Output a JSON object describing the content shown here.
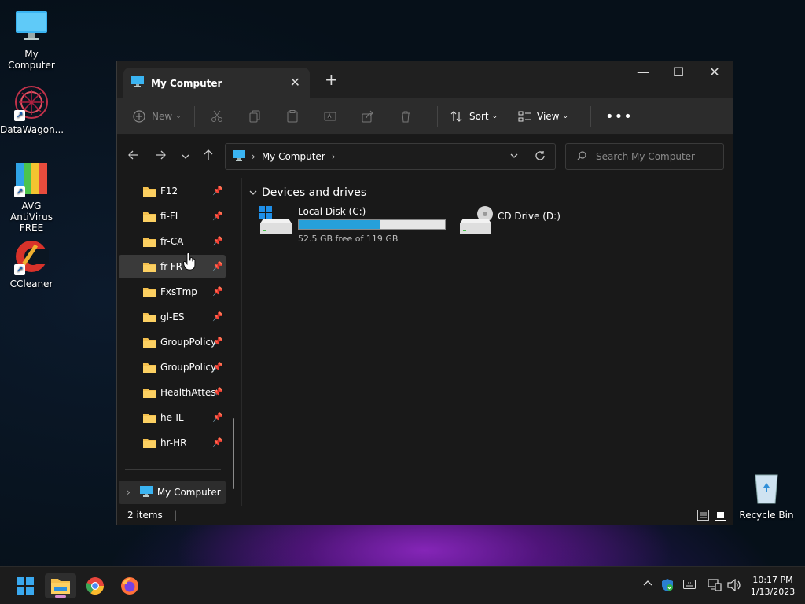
{
  "desktop": {
    "icons": [
      {
        "label": "My Computer"
      },
      {
        "label": "DataWagon..."
      },
      {
        "label": "AVG AntiVirus FREE"
      },
      {
        "label": "CCleaner"
      },
      {
        "label": "Recycle Bin"
      }
    ]
  },
  "window": {
    "tab_title": "My Computer",
    "toolbar": {
      "new_label": "New",
      "sort_label": "Sort",
      "view_label": "View"
    },
    "address": {
      "path": [
        "My Computer"
      ]
    },
    "search": {
      "placeholder": "Search My Computer"
    },
    "nav_pane": {
      "items": [
        {
          "label": "F12"
        },
        {
          "label": "fi-FI"
        },
        {
          "label": "fr-CA"
        },
        {
          "label": "fr-FR"
        },
        {
          "label": "FxsTmp"
        },
        {
          "label": "gl-ES"
        },
        {
          "label": "GroupPolicy"
        },
        {
          "label": "GroupPolicyUsers"
        },
        {
          "label": "HealthAttestation"
        },
        {
          "label": "he-IL"
        },
        {
          "label": "hr-HR"
        }
      ],
      "my_computer_label": "My Computer"
    },
    "content": {
      "group_title": "Devices and drives",
      "drives": [
        {
          "name": "Local Disk (C:)",
          "free_text": "52.5 GB free of 119 GB",
          "used_fraction": 0.56
        },
        {
          "name": "CD Drive (D:)"
        }
      ]
    },
    "status": {
      "items_count": "2 items"
    }
  },
  "taskbar": {
    "clock_time": "10:17 PM",
    "clock_date": "1/13/2023",
    "colors": {
      "accent": "#26a0da",
      "active_indicator": "#d98ccf"
    }
  }
}
